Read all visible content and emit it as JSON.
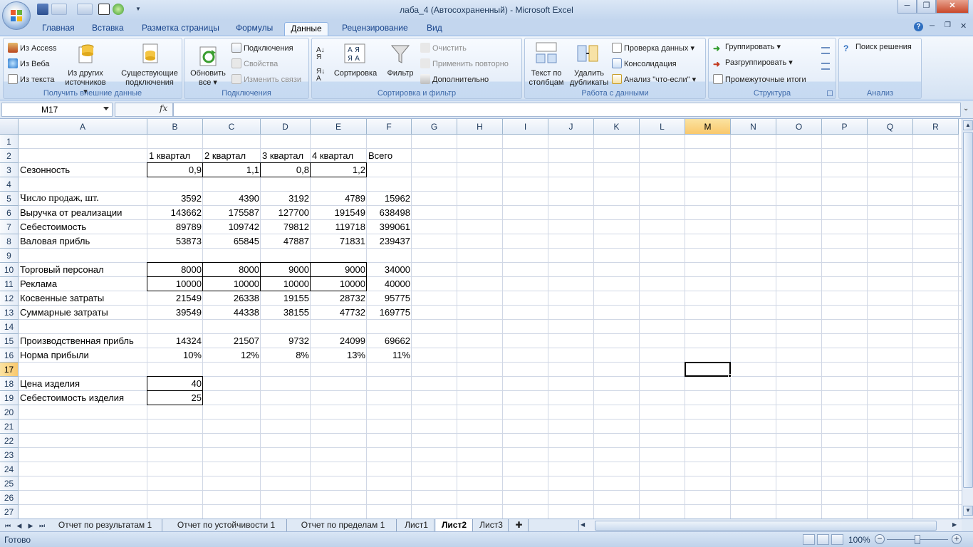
{
  "window": {
    "title": "лаба_4 (Автосохраненный) - Microsoft Excel",
    "controls": {
      "minimize": "─",
      "restore": "❐",
      "close": "✕"
    }
  },
  "ribbon_tabs": [
    "Главная",
    "Вставка",
    "Разметка страницы",
    "Формулы",
    "Данные",
    "Рецензирование",
    "Вид"
  ],
  "active_tab": "Данные",
  "ribbon": {
    "get_external": {
      "label": "Получить внешние данные",
      "from_access": "Из Access",
      "from_web": "Из Веба",
      "from_text": "Из текста",
      "from_other_1": "Из других",
      "from_other_2": "источников",
      "existing_1": "Существующие",
      "existing_2": "подключения"
    },
    "connections": {
      "label": "Подключения",
      "refresh_1": "Обновить",
      "refresh_2": "все",
      "connections": "Подключения",
      "properties": "Свойства",
      "edit_links": "Изменить связи"
    },
    "sort_filter": {
      "label": "Сортировка и фильтр",
      "sort": "Сортировка",
      "filter": "Фильтр",
      "clear": "Очистить",
      "reapply": "Применить повторно",
      "advanced": "Дополнительно"
    },
    "data_tools": {
      "label": "Работа с данными",
      "text_to_cols_1": "Текст по",
      "text_to_cols_2": "столбцам",
      "remove_dup_1": "Удалить",
      "remove_dup_2": "дубликаты",
      "validation": "Проверка данных",
      "consolidate": "Консолидация",
      "what_if": "Анализ \"что-если\""
    },
    "outline": {
      "label": "Структура",
      "group": "Группировать",
      "ungroup": "Разгруппировать",
      "subtotal": "Промежуточные итоги"
    },
    "analysis": {
      "label": "Анализ",
      "solver": "Поиск решения"
    }
  },
  "formula_bar": {
    "name_box": "M17",
    "fx": "fx",
    "formula": ""
  },
  "columns": [
    "A",
    "B",
    "C",
    "D",
    "E",
    "F",
    "G",
    "H",
    "I",
    "J",
    "K",
    "L",
    "M",
    "N",
    "O",
    "P",
    "Q",
    "R"
  ],
  "selected_column": "M",
  "rows": [
    "1",
    "2",
    "3",
    "4",
    "5",
    "6",
    "7",
    "8",
    "9",
    "10",
    "11",
    "12",
    "13",
    "14",
    "15",
    "16",
    "17",
    "18",
    "19",
    "20",
    "21",
    "22",
    "23",
    "24",
    "25",
    "26",
    "27"
  ],
  "selected_row": "17",
  "cells": {
    "B2": "1 квартал",
    "C2": "2 квартал",
    "D2": "3 квартал",
    "E2": "4 квартал",
    "F2": "Всего",
    "A3": "Сезонность",
    "B3": "0,9",
    "C3": "1,1",
    "D3": "0,8",
    "E3": "1,2",
    "A5": "Число продаж, шт.",
    "B5": "3592",
    "C5": "4390",
    "D5": "3192",
    "E5": "4789",
    "F5": "15962",
    "A6": "Выручка от реализации",
    "B6": "143662",
    "C6": "175587",
    "D6": "127700",
    "E6": "191549",
    "F6": "638498",
    "A7": "Себестоимость",
    "B7": "89789",
    "C7": "109742",
    "D7": "79812",
    "E7": "119718",
    "F7": "399061",
    "A8": "Валовая прибль",
    "B8": "53873",
    "C8": "65845",
    "D8": "47887",
    "E8": "71831",
    "F8": "239437",
    "A10": "Торговый персонал",
    "B10": "8000",
    "C10": "8000",
    "D10": "9000",
    "E10": "9000",
    "F10": "34000",
    "A11": "Реклама",
    "B11": "10000",
    "C11": "10000",
    "D11": "10000",
    "E11": "10000",
    "F11": "40000",
    "A12": "Косвенные затраты",
    "B12": "21549",
    "C12": "26338",
    "D12": "19155",
    "E12": "28732",
    "F12": "95775",
    "A13": "Суммарные затраты",
    "B13": "39549",
    "C13": "44338",
    "D13": "38155",
    "E13": "47732",
    "F13": "169775",
    "A15": "Производственная прибль",
    "B15": "14324",
    "C15": "21507",
    "D15": "9732",
    "E15": "24099",
    "F15": "69662",
    "A16": "Норма прибыли",
    "B16": "10%",
    "C16": "12%",
    "D16": "8%",
    "E16": "13%",
    "F16": "11%",
    "A18": "Цена изделия",
    "B18": "40",
    "A19": "Себестоимость изделия",
    "B19": "25"
  },
  "sheet_tabs": [
    "Отчет по результатам 1",
    "Отчет по устойчивости 1",
    "Отчет по пределам 1",
    "Лист1",
    "Лист2",
    "Лист3"
  ],
  "active_sheet": "Лист2",
  "status": {
    "ready": "Готово",
    "zoom": "100%",
    "zoom_fraction": 0.5
  }
}
